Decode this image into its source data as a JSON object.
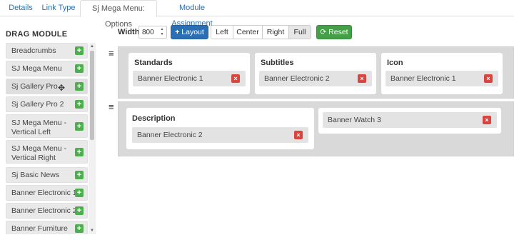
{
  "tabs": [
    {
      "label": "Details"
    },
    {
      "label": "Link Type"
    },
    {
      "label": "Sj Mega Menu: Options"
    },
    {
      "label": "Module Assignment"
    }
  ],
  "drag_module": {
    "title": "DRAG MODULE",
    "items": [
      {
        "label": "Breadcrumbs"
      },
      {
        "label": "SJ Mega Menu"
      },
      {
        "label": "Sj Gallery Pro"
      },
      {
        "label": "Sj Gallery Pro 2"
      },
      {
        "label": "SJ Mega Menu - Vertical Left"
      },
      {
        "label": "SJ Mega Menu - Vertical Right"
      },
      {
        "label": "Sj Basic News"
      },
      {
        "label": "Banner Electronic 1"
      },
      {
        "label": "Banner Electronic 2"
      },
      {
        "label": "Banner Furniture"
      }
    ],
    "add_icon": "+"
  },
  "toolbar": {
    "width_label": "Width",
    "width_value": "800",
    "layout_label": "Layout",
    "align_left": "Left",
    "align_center": "Center",
    "align_right": "Right",
    "align_full": "Full",
    "reset_label": "Reset"
  },
  "rows": [
    {
      "columns": [
        {
          "title": "Standards",
          "modules": [
            "Banner Electronic 1"
          ]
        },
        {
          "title": "Subtitles",
          "modules": [
            "Banner Electronic 2"
          ]
        },
        {
          "title": "Icon",
          "modules": [
            "Banner Electronic 1"
          ]
        }
      ]
    },
    {
      "columns": [
        {
          "title": "Description",
          "modules": [
            "Banner Electronic 2"
          ]
        },
        {
          "title": "",
          "modules": [
            "Banner Watch 3"
          ]
        }
      ]
    }
  ],
  "icons": {
    "remove": "×",
    "handle": "≡"
  },
  "colors": {
    "primary": "#2a6fb5",
    "success": "#43a047",
    "danger": "#d9453e",
    "add": "#4cae4c",
    "tab_link": "#2a6fb0"
  }
}
